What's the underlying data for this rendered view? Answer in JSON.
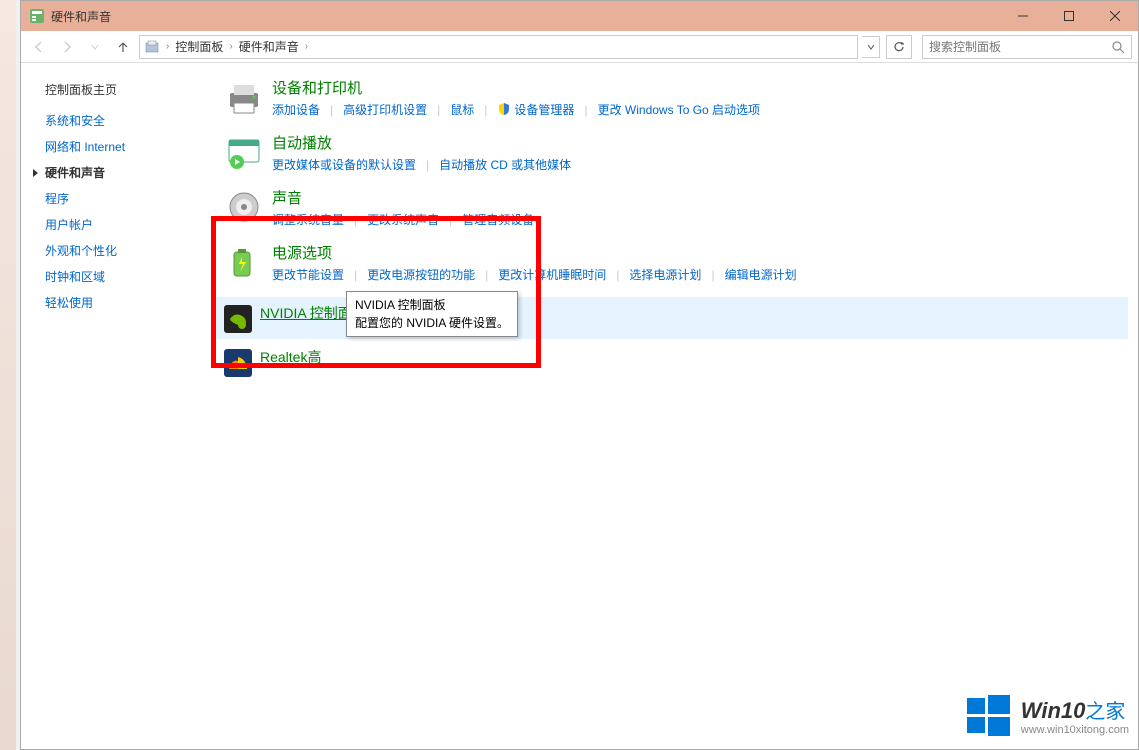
{
  "window": {
    "title": "硬件和声音"
  },
  "breadcrumb": {
    "items": [
      "控制面板",
      "硬件和声音"
    ]
  },
  "search": {
    "placeholder": "搜索控制面板"
  },
  "sidebar": {
    "home": "控制面板主页",
    "items": [
      {
        "label": "系统和安全",
        "active": false
      },
      {
        "label": "网络和 Internet",
        "active": false
      },
      {
        "label": "硬件和声音",
        "active": true
      },
      {
        "label": "程序",
        "active": false
      },
      {
        "label": "用户帐户",
        "active": false
      },
      {
        "label": "外观和个性化",
        "active": false
      },
      {
        "label": "时钟和区域",
        "active": false
      },
      {
        "label": "轻松使用",
        "active": false
      }
    ]
  },
  "categories": [
    {
      "icon": "printer",
      "title": "设备和打印机",
      "links": [
        "添加设备",
        "高级打印机设置",
        "鼠标",
        "设备管理器",
        "更改 Windows To Go 启动选项"
      ],
      "shield_index": 3
    },
    {
      "icon": "autoplay",
      "title": "自动播放",
      "links": [
        "更改媒体或设备的默认设置",
        "自动播放 CD 或其他媒体"
      ]
    },
    {
      "icon": "sound",
      "title": "声音",
      "links": [
        "调整系统音量",
        "更改系统声音",
        "管理音频设备"
      ]
    },
    {
      "icon": "power",
      "title": "电源选项",
      "links": [
        "更改节能设置",
        "更改电源按钮的功能",
        "更改计算机睡眠时间",
        "选择电源计划",
        "编辑电源计划"
      ]
    },
    {
      "icon": "nvidia",
      "title": "NVIDIA 控制面板",
      "links": [],
      "highlighted": true
    },
    {
      "icon": "realtek",
      "title": "Realtek高",
      "links": []
    }
  ],
  "tooltip": {
    "line1": "NVIDIA 控制面板",
    "line2": "配置您的 NVIDIA 硬件设置。"
  },
  "watermark": {
    "brand": "Win10",
    "suffix": "之家",
    "url": "www.win10xitong.com"
  }
}
